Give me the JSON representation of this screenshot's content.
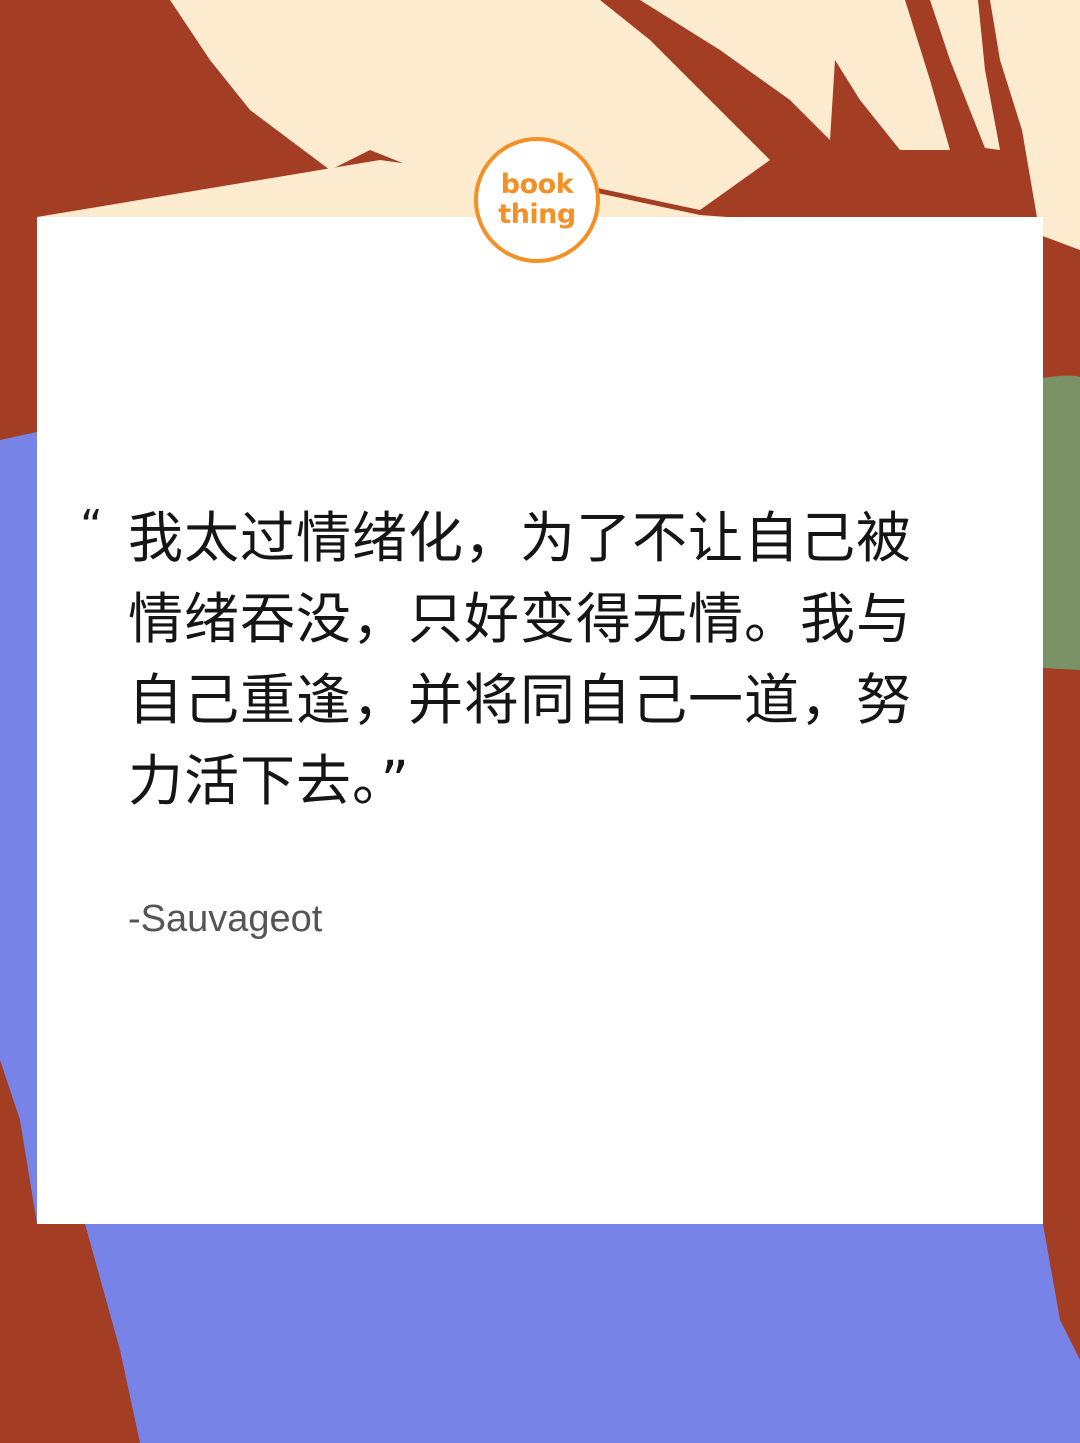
{
  "logo": {
    "line1": "book",
    "line2": "thing"
  },
  "quote": {
    "open_mark": "“",
    "lines": [
      "我太过情绪化，为了不让自己被",
      "情绪吞没，只好变得无情。我与",
      "自己重逢，并将同自己一道，努",
      "力活下去。”"
    ]
  },
  "author": "-Sauvageot",
  "colors": {
    "rust": "#a33e24",
    "cream": "#fdebd0",
    "periwinkle": "#7783e6",
    "olive": "#7a9266",
    "logo_orange": "#f39026",
    "card": "#ffffff"
  }
}
